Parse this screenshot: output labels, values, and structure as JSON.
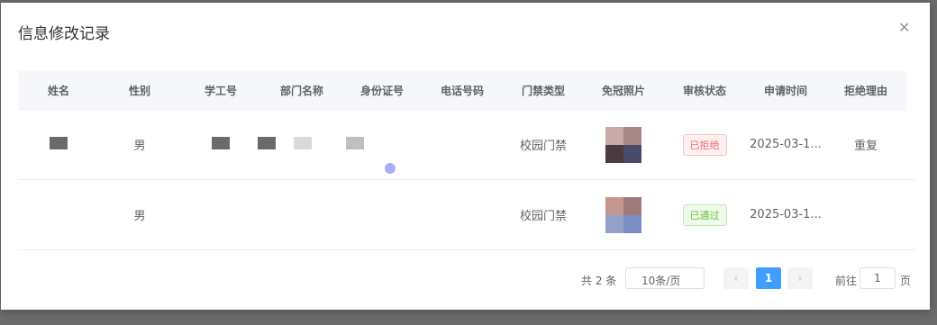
{
  "dialog": {
    "title": "信息修改记录"
  },
  "table": {
    "columns": [
      "姓名",
      "性别",
      "学工号",
      "部门名称",
      "身份证号",
      "电话号码",
      "门禁类型",
      "免冠照片",
      "审核状态",
      "申请时间",
      "拒绝理由"
    ],
    "rows": [
      {
        "gender": "男",
        "access_type": "校园门禁",
        "status": "已拒绝",
        "apply_time": "2025-03-1...",
        "reason": "重复"
      },
      {
        "gender": "男",
        "access_type": "校园门禁",
        "status": "已通过",
        "apply_time": "2025-03-1...",
        "reason": ""
      }
    ]
  },
  "pagination": {
    "total": "共 2 条",
    "page_size": "10条/页",
    "current_page": "1",
    "goto_prefix": "前往",
    "goto_value": "1",
    "goto_suffix": "页"
  },
  "colors": {
    "accent": "#409eff",
    "rejected": "#f56c6c",
    "approved": "#67c23a"
  }
}
